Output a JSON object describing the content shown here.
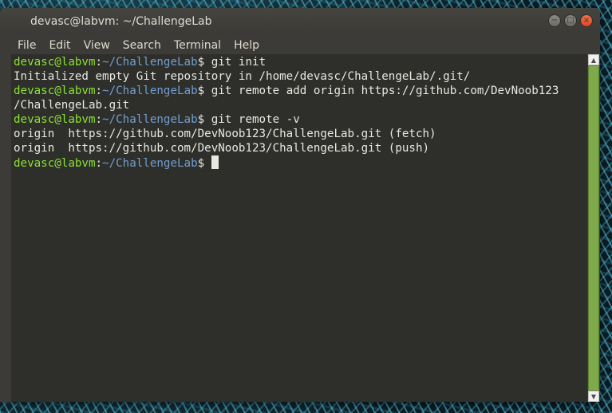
{
  "window": {
    "title": "devasc@labvm: ~/ChallengeLab",
    "controls": {
      "minimize": "−",
      "maximize": "□",
      "close": "×"
    }
  },
  "menubar": {
    "items": [
      "File",
      "Edit",
      "View",
      "Search",
      "Terminal",
      "Help"
    ]
  },
  "terminal": {
    "prompt_user": "devasc@labvm",
    "prompt_sep": ":",
    "prompt_path": "~/ChallengeLab",
    "prompt_dollar": "$ ",
    "lines": [
      {
        "type": "prompt",
        "cmd": "git init"
      },
      {
        "type": "output",
        "text": "Initialized empty Git repository in /home/devasc/ChallengeLab/.git/"
      },
      {
        "type": "prompt",
        "cmd": "git remote add origin https://github.com/DevNoob123"
      },
      {
        "type": "output",
        "text": "/ChallengeLab.git"
      },
      {
        "type": "prompt",
        "cmd": "git remote -v"
      },
      {
        "type": "output",
        "text": "origin  https://github.com/DevNoob123/ChallengeLab.git (fetch)"
      },
      {
        "type": "output",
        "text": "origin  https://github.com/DevNoob123/ChallengeLab.git (push)"
      },
      {
        "type": "prompt",
        "cmd": "",
        "cursor": true
      }
    ]
  },
  "scrollbar": {
    "up_arrow": "▲",
    "down_arrow": "▼"
  },
  "colors": {
    "prompt_user": "#8ae234",
    "prompt_path": "#729fcf",
    "terminal_bg": "#2e2e2a",
    "close_button": "#e3461f",
    "scroll_thumb": "#7faa4b"
  }
}
